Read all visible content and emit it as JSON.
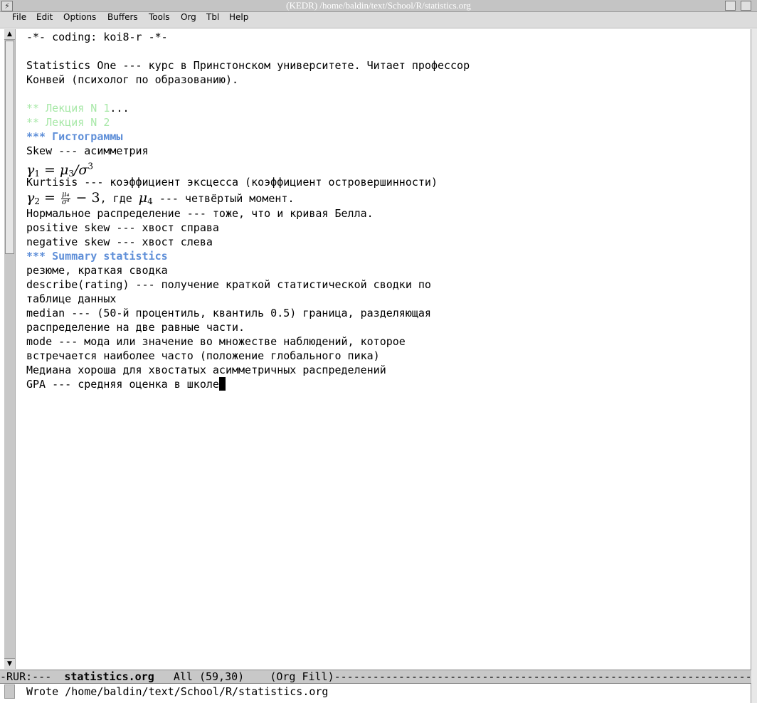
{
  "window": {
    "title": "(KEDR) /home/baldin/text/School/R/statistics.org",
    "title_icon": "⚡"
  },
  "menu": [
    "File",
    "Edit",
    "Options",
    "Buffers",
    "Tools",
    "Org",
    "Tbl",
    "Help"
  ],
  "buffer": {
    "lines": {
      "l1": "-*- coding: koi8-r -*-",
      "l3": "Statistics One --- курс в Принстонском университете. Читает профессор",
      "l4": "Конвей (психолог по образованию).",
      "l6_heading": "** Лекция N 1",
      "l6_ellipsis": "...",
      "l7_heading": "** Лекция N 2",
      "l8_heading": "*** Гистограммы",
      "l9": "Skew --- асимметрия",
      "l10_math": {
        "gamma": "γ",
        "eq": " = ",
        "mu": "μ",
        "sub1": "1",
        "sub3": "3",
        "slash": "/",
        "sigma": "σ",
        "sup3": "3"
      },
      "l11": "Kurtisis --- коэффициент эксцесса (коэффициент островершинности)",
      "l12_math": {
        "gamma": "γ",
        "sub2": "2",
        "eq": " = ",
        "num": "μ₄",
        "den": "σ⁴",
        "minus3": " − 3"
      },
      "l12_text1": ", где ",
      "l12_mu4": "μ",
      "l12_sub4": "4",
      "l12_text2": " --- четвёртый момент.",
      "l13": "Нормальное распределение --- тоже, что и кривая Белла.",
      "l14": "positive skew --- хвост справа",
      "l15": "negative skew --- хвост слева",
      "l16_heading": "*** Summary statistics",
      "l17": "резюме, краткая сводка",
      "l18": "describe(rating) --- получение краткой статистической сводки по",
      "l19": "таблице данных",
      "l20": "median --- (50-й процентиль, квантиль 0.5) граница, разделяющая",
      "l21": "распределение на две равные части.",
      "l22": "mode --- мода или значение во множестве наблюдений, которое",
      "l23": "встречается наиболее часто (положение глобального пика)",
      "l24": "Медиана хороша для хвостатых асимметричных распределений",
      "l25": "GPA --- средняя оценка в школе"
    }
  },
  "modeline": {
    "prefix": "-RUR:---  ",
    "buffer_name": "statistics.org",
    "position": "   All (59,30)    ",
    "mode": "(Org Fill)",
    "dashes": "------------------------------------------------------------------"
  },
  "echo": "Wrote /home/baldin/text/School/R/statistics.org",
  "scrollbar": {
    "up_arrow": "▲",
    "down_arrow": "▼"
  },
  "colors": {
    "heading2": "#a8e8a8",
    "heading3": "#5f8fd8"
  }
}
